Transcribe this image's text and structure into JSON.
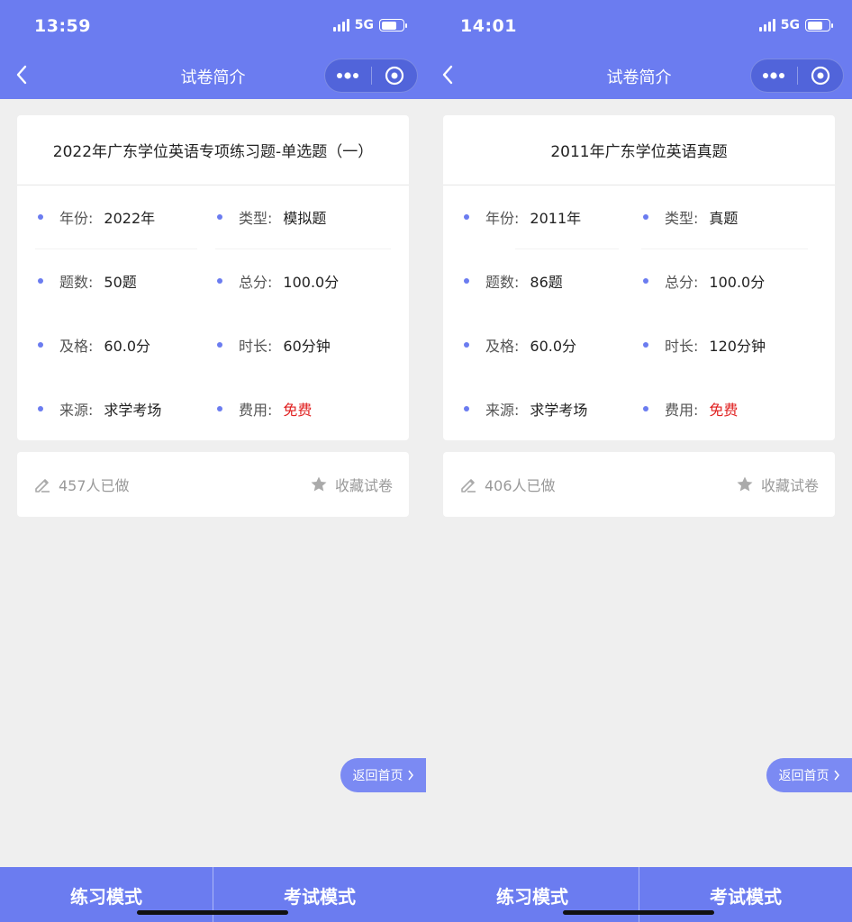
{
  "screens": [
    {
      "status": {
        "time": "13:59",
        "network": "5G"
      },
      "nav": {
        "title": "试卷简介"
      },
      "paper": {
        "title": "2022年广东学位英语专项练习题-单选题（一）",
        "fields": [
          {
            "label": "年份:",
            "value": "2022年"
          },
          {
            "label": "类型:",
            "value": "模拟题"
          },
          {
            "label": "题数:",
            "value": "50题"
          },
          {
            "label": "总分:",
            "value": "100.0分"
          },
          {
            "label": "及格:",
            "value": "60.0分"
          },
          {
            "label": "时长:",
            "value": "60分钟"
          },
          {
            "label": "来源:",
            "value": "求学考场"
          },
          {
            "label": "费用:",
            "value": "免费"
          }
        ]
      },
      "stats": {
        "done": "457人已做",
        "favorite": "收藏试卷"
      },
      "home_button": "返回首页",
      "modes": {
        "practice": "练习模式",
        "exam": "考试模式"
      }
    },
    {
      "status": {
        "time": "14:01",
        "network": "5G"
      },
      "nav": {
        "title": "试卷简介"
      },
      "paper": {
        "title": "2011年广东学位英语真题",
        "fields": [
          {
            "label": "年份:",
            "value": "2011年"
          },
          {
            "label": "类型:",
            "value": "真题"
          },
          {
            "label": "题数:",
            "value": "86题"
          },
          {
            "label": "总分:",
            "value": "100.0分"
          },
          {
            "label": "及格:",
            "value": "60.0分"
          },
          {
            "label": "时长:",
            "value": "120分钟"
          },
          {
            "label": "来源:",
            "value": "求学考场"
          },
          {
            "label": "费用:",
            "value": "免费"
          }
        ]
      },
      "stats": {
        "done": "406人已做",
        "favorite": "收藏试卷"
      },
      "home_button": "返回首页",
      "modes": {
        "practice": "练习模式",
        "exam": "考试模式"
      }
    }
  ],
  "colors": {
    "primary": "#6b7cf0",
    "free": "#e02020",
    "muted": "#999999"
  },
  "icons": [
    "back-chevron-icon",
    "more-dots-icon",
    "close-target-icon",
    "pencil-icon",
    "star-icon",
    "chevron-right-icon"
  ]
}
